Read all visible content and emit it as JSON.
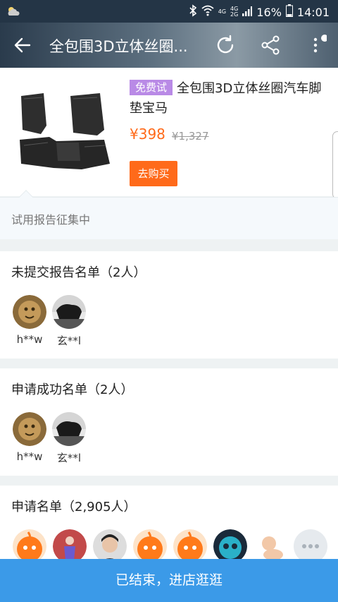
{
  "status_bar": {
    "network": "4G",
    "network2_top": "4G",
    "network2_bottom": "2G",
    "battery": "16%",
    "time": "14:01"
  },
  "header": {
    "title": "全包围3D立体丝圈..."
  },
  "product": {
    "badge": "免费试",
    "title": "全包围3D立体丝圈汽车脚垫宝马",
    "price": "¥398",
    "old_price": "¥1,327",
    "buy_label": "去购买"
  },
  "notice": {
    "text": "试用报告征集中"
  },
  "sections": [
    {
      "title": "未提交报告名单（2人）",
      "users": [
        {
          "name": "h**w",
          "avatar": "lion"
        },
        {
          "name": "玄**l",
          "avatar": "animal-bw"
        }
      ]
    },
    {
      "title": "申请成功名单（2人）",
      "users": [
        {
          "name": "h**w",
          "avatar": "lion"
        },
        {
          "name": "玄**l",
          "avatar": "animal-bw"
        }
      ]
    },
    {
      "title": "申请名单（2,905人）",
      "avatars": [
        "mascot-orange",
        "dancer",
        "boy",
        "mascot-orange",
        "mascot-orange",
        "blue-creature",
        "baby",
        "more"
      ]
    }
  ],
  "bottom_bar": {
    "label": "已结束，进店逛逛"
  },
  "colors": {
    "accent_orange": "#ff6a1a",
    "badge_purple": "#b98ae6",
    "bottom_blue": "#3b9ae8",
    "status_bar": "#243546"
  }
}
